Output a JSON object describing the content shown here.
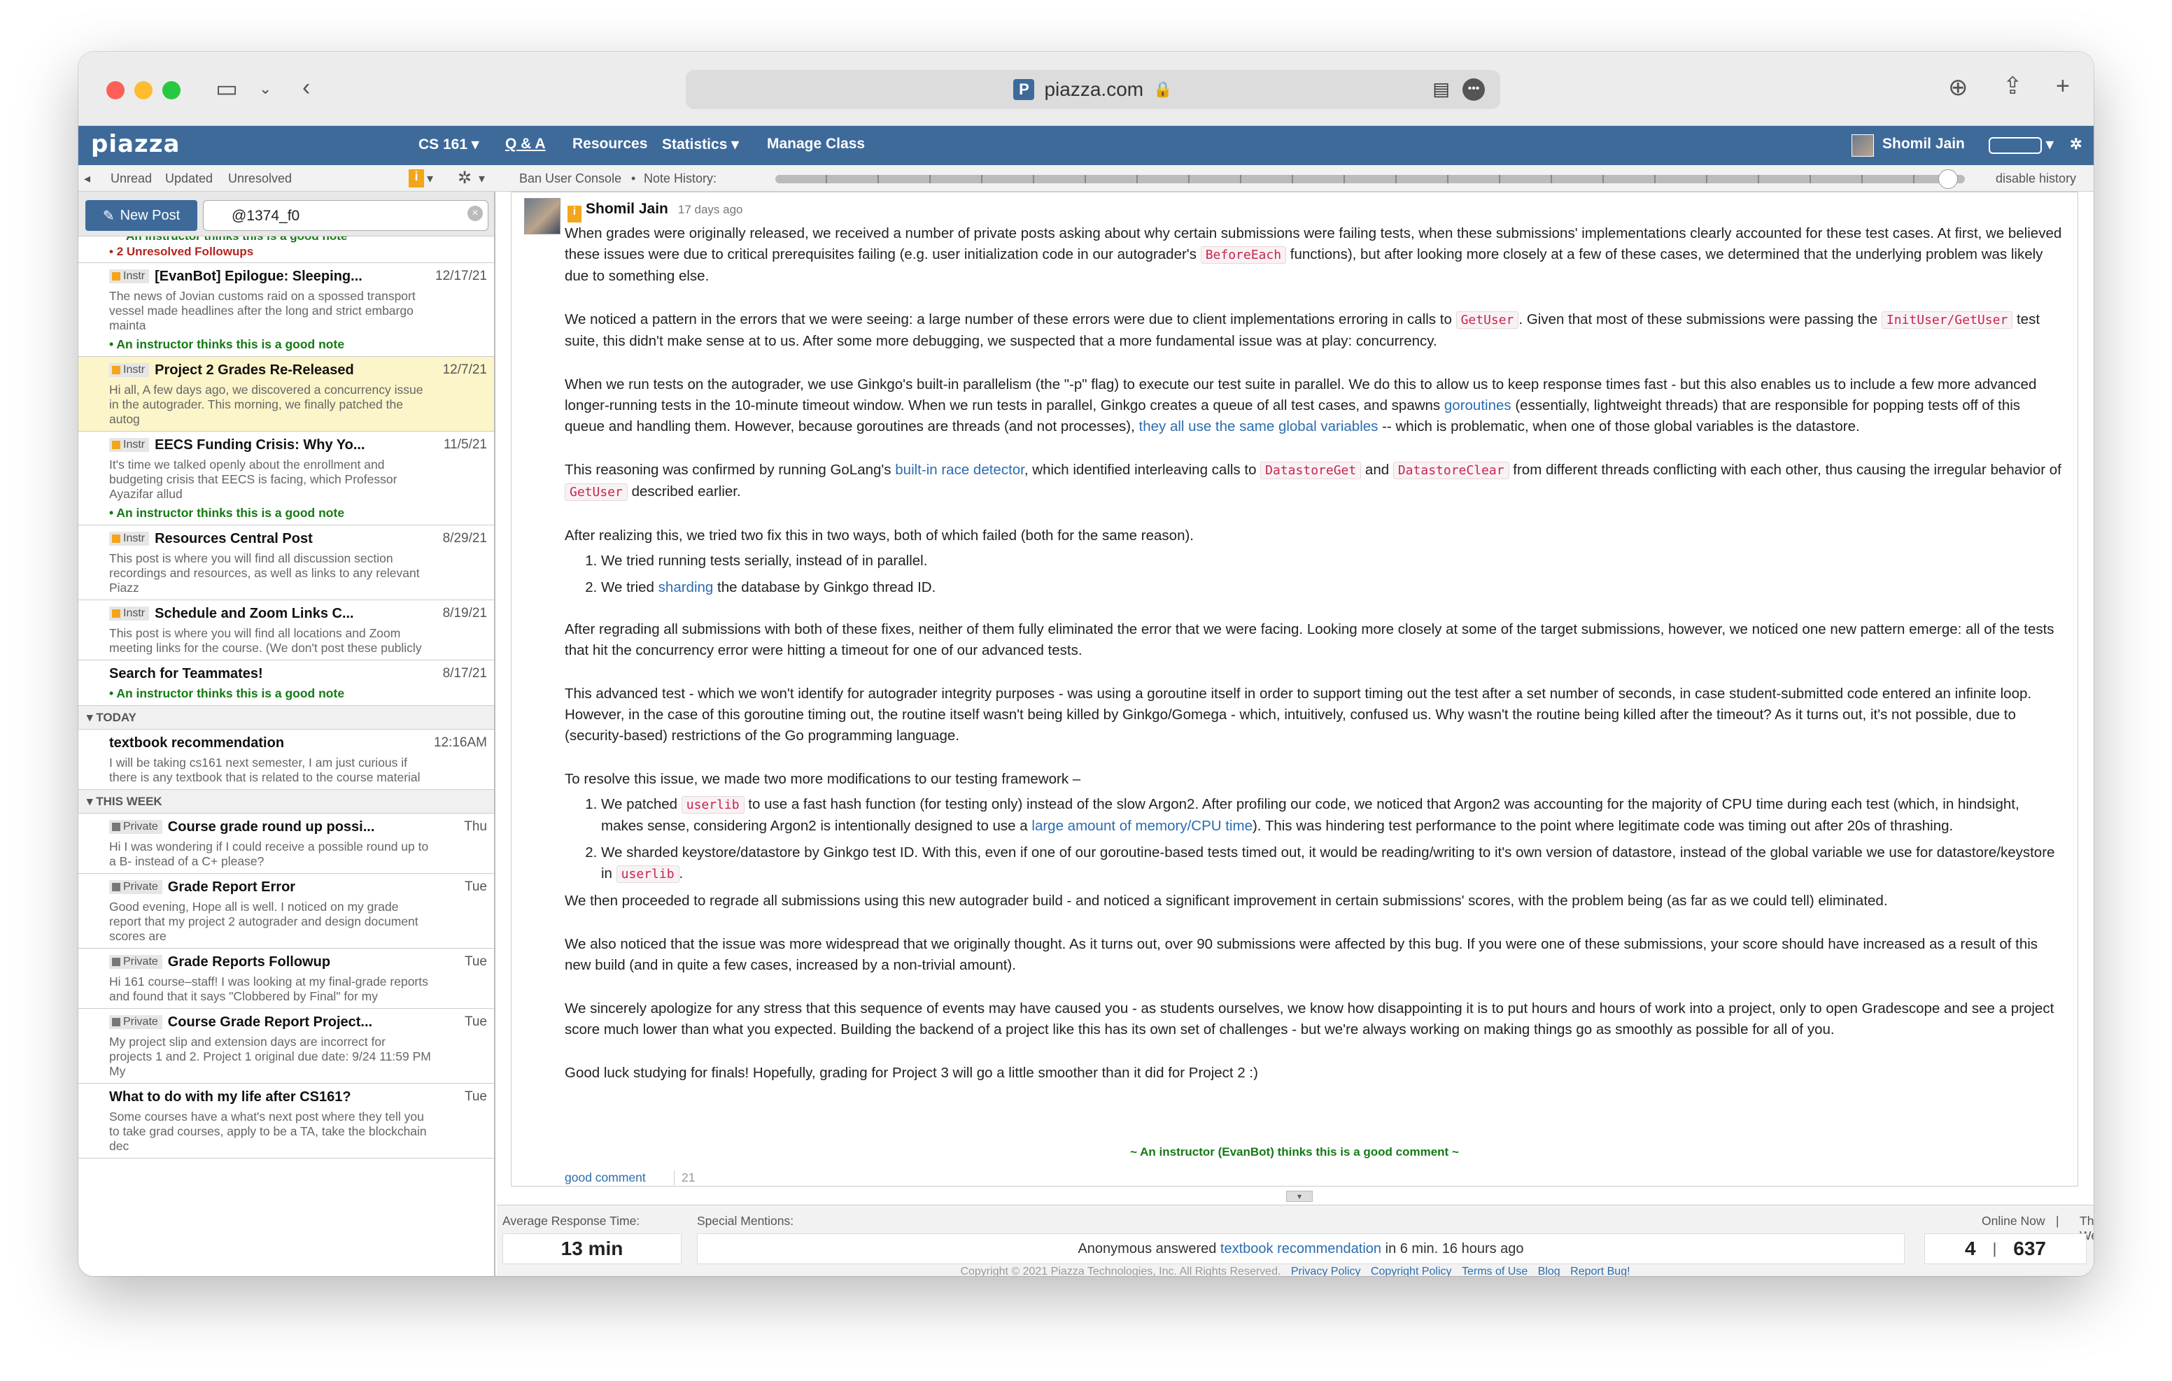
{
  "browser": {
    "url": "piazza.com"
  },
  "nav": {
    "brand": "piazza",
    "course": "CS 161",
    "items": [
      "Q & A",
      "Resources",
      "Statistics",
      "Manage Class"
    ],
    "user": "Shomil Jain"
  },
  "subbar": {
    "filters": [
      "Unread",
      "Updated",
      "Unresolved"
    ],
    "ban_console": "Ban User Console",
    "note_history": "Note History:",
    "disable_history": "disable history"
  },
  "sidebar": {
    "new_post": "New Post",
    "search_value": "@1374_f0",
    "partial_top": "An instructor thinks this is a good note",
    "partial_unresolved": "2 Unresolved Followups",
    "posts": [
      {
        "tag": "Instr",
        "title": "[EvanBot] Epilogue: Sleeping...",
        "date": "12/17/21",
        "snippet": "The news of Jovian customs raid on a spossed transport vessel made headlines after the long and strict embargo mainta",
        "good": "An instructor thinks this is a good note"
      },
      {
        "tag": "Instr",
        "title": "Project 2 Grades Re-Released",
        "date": "12/7/21",
        "snippet": "Hi all, A few days ago, we discovered a concurrency issue in the autograder. This morning, we finally patched the autog",
        "good": ""
      },
      {
        "tag": "Instr",
        "title": "EECS Funding Crisis: Why Yo...",
        "date": "11/5/21",
        "snippet": "It's time we talked openly about the enrollment and budgeting crisis that EECS is facing, which Professor Ayazifar allud",
        "good": "An instructor thinks this is a good note"
      },
      {
        "tag": "Instr",
        "title": "Resources Central Post",
        "date": "8/29/21",
        "snippet": "This post is where you will find all discussion section recordings and resources, as well as links to any relevant Piazz",
        "good": ""
      },
      {
        "tag": "Instr",
        "title": "Schedule and Zoom Links C...",
        "date": "8/19/21",
        "snippet": "This post is where you will find all locations and Zoom meeting links for the course. (We don't post these publicly",
        "good": ""
      },
      {
        "tag": "",
        "title": "Search for Teammates!",
        "date": "8/17/21",
        "snippet": "",
        "good": "An instructor thinks this is a good note"
      }
    ],
    "today_label": "TODAY",
    "today_posts": [
      {
        "tag": "",
        "title": "textbook recommendation",
        "date": "12:16AM",
        "snippet": "I will be taking cs161 next semester, I am just curious if there is any textbook that is related to the course material",
        "good": ""
      }
    ],
    "week_label": "THIS WEEK",
    "week_posts": [
      {
        "tag": "Private",
        "title": "Course grade round up possi...",
        "date": "Thu",
        "snippet": "Hi I was wondering if I could receive a possible round up to a B- instead of a C+ please?",
        "good": ""
      },
      {
        "tag": "Private",
        "title": "Grade Report Error",
        "date": "Tue",
        "snippet": "Good evening, Hope all is well. I noticed on my grade report that my project 2 autograder and design document scores are",
        "good": ""
      },
      {
        "tag": "Private",
        "title": "Grade Reports Followup",
        "date": "Tue",
        "snippet": "Hi 161 course–staff! I was looking at my final-grade reports and found that it says \"Clobbered by Final\" for my",
        "good": ""
      },
      {
        "tag": "Private",
        "title": "Course Grade Report Project...",
        "date": "Tue",
        "snippet": "My project slip and extension days are incorrect for projects 1 and 2. Project 1 original due date: 9/24 11:59 PM My",
        "good": ""
      },
      {
        "tag": "",
        "title": "What to do with my life after CS161?",
        "date": "Tue",
        "snippet": "Some courses have a what's next post where they tell you to take grad courses, apply to be a TA, take the blockchain dec",
        "good": ""
      }
    ]
  },
  "note": {
    "author": "Shomil Jain",
    "ago": "17 days ago",
    "p1a": "When grades were originally released, we received a number of private posts asking about why certain submissions were failing tests, when these submissions' implementations clearly accounted for these test cases. At first, we believed these issues were due to critical prerequisites failing (e.g. user initialization code in our autograder's",
    "p1code": "BeforeEach",
    "p1b": "functions), but after looking more closely at a few of these cases, we determined that the underlying problem was likely due to something else.",
    "p2a": "We noticed a pattern in the errors that we were seeing: a large number of these errors were due to client implementations erroring in calls to",
    "p2code1": "GetUser",
    "p2b": ". Given that most of these submissions were passing the",
    "p2code2": "InitUser/GetUser",
    "p2c": "test suite, this didn't make sense at to us. After some more debugging, we suspected that a more fundamental issue was at play: concurrency.",
    "p3a": "When we run tests on the autograder, we use Ginkgo's built-in parallelism (the \"-p\" flag) to execute our test suite in parallel. We do this to allow us to keep response times fast - but this also enables us to include a few more advanced longer-running tests in the 10-minute timeout window. When we run tests in parallel, Ginkgo creates a queue of all test cases, and spawns",
    "p3link1": "goroutines",
    "p3b": "(essentially, lightweight threads) that are responsible for popping tests off of this queue and handling them. However, because goroutines are threads (and not processes),",
    "p3link2": "they all use the same global variables",
    "p3c": "-- which is problematic, when one of those global variables is the datastore.",
    "p4a": "This reasoning was confirmed by running GoLang's",
    "p4link": "built-in race detector",
    "p4b": ", which identified interleaving calls to",
    "p4code1": "DatastoreGet",
    "p4c": "and",
    "p4code2": "DatastoreClear",
    "p4d": "from different threads conflicting with each other, thus causing the irregular behavior of",
    "p4code3": "GetUser",
    "p4e": "described earlier.",
    "p5": "After realizing this, we tried two fix this in two ways, both of which failed (both for the same reason).",
    "p5li1": "We tried running tests serially, instead of in parallel.",
    "p5li2a": "We tried",
    "p5li2link": "sharding",
    "p5li2b": "the database by Ginkgo thread ID.",
    "p6": "After regrading all submissions with both of these fixes, neither of them fully eliminated the error that we were facing. Looking more closely at some of the target submissions, however, we noticed one new pattern emerge: all of the tests that hit the concurrency error were hitting a timeout for one of our advanced tests.",
    "p7": "This advanced test - which we won't identify for autograder integrity purposes - was using a goroutine itself in order to support timing out the test after a set number of seconds, in case student-submitted code entered an infinite loop. However, in the case of this goroutine timing out, the routine itself wasn't being killed by Ginkgo/Gomega - which, intuitively, confused us. Why wasn't the routine being killed after the timeout? As it turns out, it's not possible, due to (security-based) restrictions of the Go programming language.",
    "p8": "To resolve this issue, we made two more modifications to our testing framework –",
    "p8li1a": "We patched",
    "p8li1code": "userlib",
    "p8li1b": "to use a fast hash function (for testing only) instead of the slow Argon2. After profiling our code, we noticed that Argon2 was accounting for the majority of CPU time during each test (which, in hindsight, makes sense, considering Argon2 is intentionally designed to use a",
    "p8li1link": "large amount of memory/CPU time",
    "p8li1c": "). This was hindering test performance to the point where legitimate code was timing out after 20s of thrashing.",
    "p8li2a": "We sharded keystore/datastore by Ginkgo test ID. With this, even if one of our goroutine-based tests timed out, it would be reading/writing to it's own version of datastore, instead of the global variable we use for datastore/keystore in",
    "p8li2code": "userlib",
    "p8li2b": ".",
    "p9": "We then proceeded to regrade all submissions using this new autograder build - and noticed a significant improvement in certain submissions' scores, with the problem being (as far as we could tell) eliminated.",
    "p10": "We also noticed that the issue was more widespread that we originally thought. As it turns out, over 90 submissions were affected by this bug. If you were one of these submissions, your score should have increased as a result of this new build (and in quite a few cases, increased by a non-trivial amount).",
    "p11": "We sincerely apologize for any stress that this sequence of events may have caused you - as students ourselves, we know how disappointing it is to put hours and hours of work into a project, only to open Gradescope and see a project score much lower than what you expected. Building the backend of a project like this has its own set of challenges - but we're always working on making things go as smoothly as possible for all of you.",
    "p12": "Good luck studying for finals! Hopefully, grading for Project 3 will go a little smoother than it did for Project 2 :)",
    "good_note": "~ An instructor (EvanBot) thinks this is a good comment ~",
    "good_comment": "good comment",
    "good_count": "21"
  },
  "footer": {
    "avg_label": "Average Response Time:",
    "avg_value": "13 min",
    "mentions_label": "Special Mentions:",
    "mention_a": "Anonymous answered",
    "mention_link": "textbook recommendation",
    "mention_b": "in 6 min. 16 hours ago",
    "online_label": "Online Now",
    "week_label": "This Week:",
    "online_value": "4",
    "week_value": "637",
    "copyright": "Copyright © 2021 Piazza Technologies, Inc. All Rights Reserved.",
    "links": [
      "Privacy Policy",
      "Copyright Policy",
      "Terms of Use",
      "Blog",
      "Report Bug!"
    ]
  },
  "colors": {
    "brand": "#3e6a9a",
    "good": "#157a15",
    "link": "#2b6cb0",
    "selected": "#fcf5c9"
  }
}
